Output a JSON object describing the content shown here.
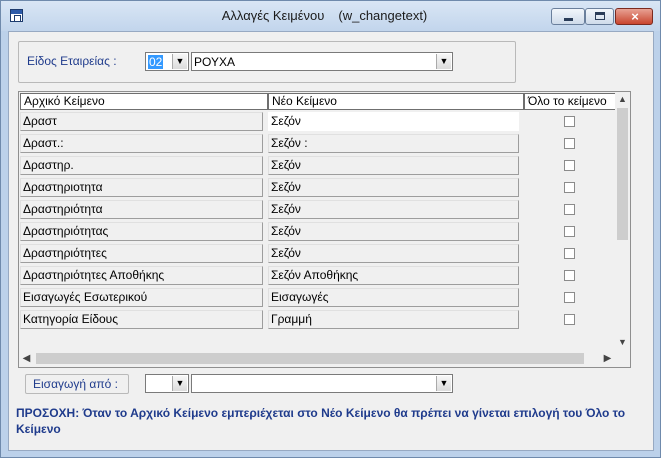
{
  "window": {
    "title": "Αλλαγές Κειμένου",
    "title_id": "(w_changetext)",
    "close_glyph": "×"
  },
  "filter": {
    "label": "Είδος Εταιρείας :",
    "code_value": "02",
    "name_value": "ΡΟΥΧΑ"
  },
  "grid": {
    "columns": [
      "Αρχικό Κείμενο",
      "Νέο Κείμενο",
      "Όλο το κείμενο"
    ],
    "rows": [
      {
        "original": "Δραστ",
        "new": "Σεζόν",
        "whole_text": false
      },
      {
        "original": "Δραστ.:",
        "new": "Σεζόν :",
        "whole_text": false
      },
      {
        "original": "Δραστηρ.",
        "new": "Σεζόν",
        "whole_text": false
      },
      {
        "original": "Δραστηριοτητα",
        "new": "Σεζόν",
        "whole_text": false
      },
      {
        "original": "Δραστηριότητα",
        "new": "Σεζόν",
        "whole_text": false
      },
      {
        "original": "Δραστηριότητας",
        "new": "Σεζόν",
        "whole_text": false
      },
      {
        "original": "Δραστηριότητες",
        "new": "Σεζόν",
        "whole_text": false
      },
      {
        "original": "Δραστηριότητες Αποθήκης",
        "new": "Σεζόν Αποθήκης",
        "whole_text": false
      },
      {
        "original": "Εισαγωγές Εσωτερικού",
        "new": "Εισαγωγές",
        "whole_text": false
      },
      {
        "original": "Κατηγορία Είδους",
        "new": "Γραμμή",
        "whole_text": false
      }
    ],
    "active_row": 0
  },
  "import": {
    "label": "Εισαγωγή από :",
    "code_value": "",
    "name_value": ""
  },
  "warning": "ΠΡΟΣΟΧΗ: Όταν το Αρχικό Κείμενο εμπεριέχεται στο Νέο Κείμενο θα πρέπει να γίνεται επιλογή του Όλο το Κείμενο",
  "icons": {
    "app": "app-window-icon",
    "minimize": "minimize-icon",
    "maximize": "maximize-icon",
    "close": "close-icon",
    "dropdown": "chevron-down-icon",
    "scroll_up": "chevron-up-icon",
    "scroll_down": "chevron-down-icon",
    "scroll_left": "chevron-left-icon",
    "scroll_right": "chevron-right-icon"
  },
  "colors": {
    "label_blue": "#1f3b8c",
    "titlebar": "#c2d5ec",
    "close_red": "#c9452e"
  }
}
